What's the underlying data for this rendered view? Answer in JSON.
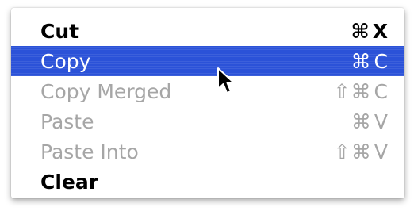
{
  "menu": {
    "items": [
      {
        "label": "Cut",
        "modifiers": "⌘",
        "key": "X",
        "state": "enabled",
        "weight": "bold"
      },
      {
        "label": "Copy",
        "modifiers": "⌘",
        "key": "C",
        "state": "selected",
        "weight": "normal"
      },
      {
        "label": "Copy Merged",
        "modifiers": "⇧⌘",
        "key": "C",
        "state": "disabled",
        "weight": "normal"
      },
      {
        "label": "Paste",
        "modifiers": "⌘",
        "key": "V",
        "state": "disabled",
        "weight": "normal"
      },
      {
        "label": "Paste Into",
        "modifiers": "⇧⌘",
        "key": "V",
        "state": "disabled",
        "weight": "normal"
      },
      {
        "label": "Clear",
        "modifiers": "",
        "key": "",
        "state": "enabled",
        "weight": "bold"
      }
    ]
  },
  "cursor": {
    "icon": "arrow-pointer-icon"
  },
  "colors": {
    "highlight": "#2b52d8",
    "disabled_text": "#a6a6a6",
    "enabled_text": "#000000",
    "selected_text": "#ffffff"
  }
}
